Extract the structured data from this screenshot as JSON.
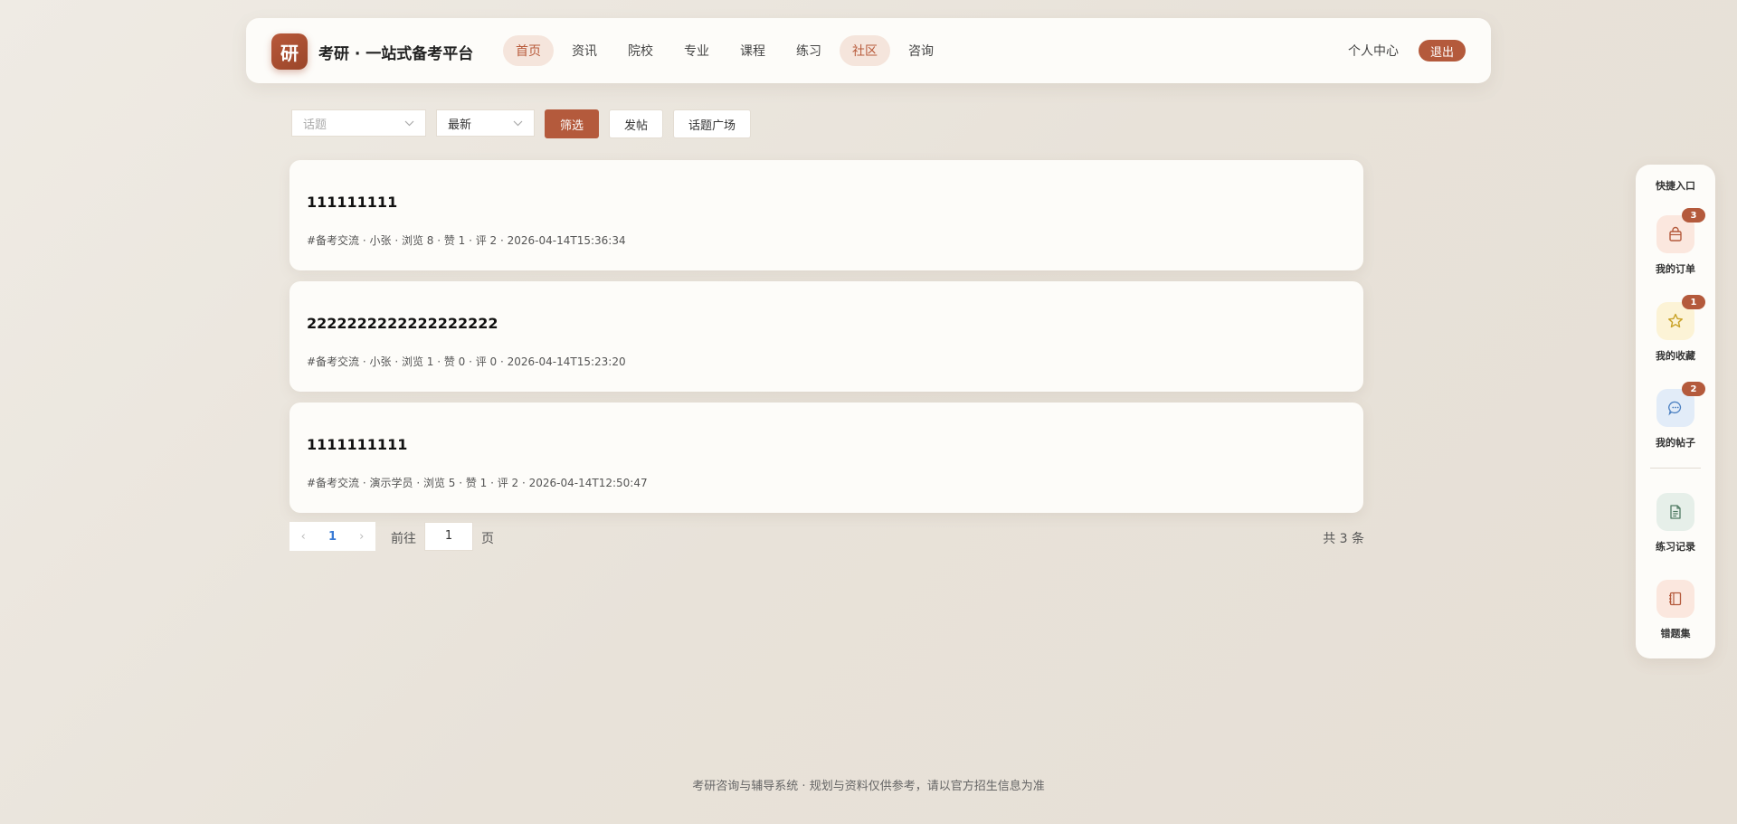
{
  "header": {
    "logo_char": "研",
    "brand": "考研 · 一站式备考平台",
    "nav": [
      {
        "label": "首页",
        "active": true
      },
      {
        "label": "资讯",
        "active": false
      },
      {
        "label": "院校",
        "active": false
      },
      {
        "label": "专业",
        "active": false
      },
      {
        "label": "课程",
        "active": false
      },
      {
        "label": "练习",
        "active": false
      },
      {
        "label": "社区",
        "active": true
      },
      {
        "label": "咨询",
        "active": false
      }
    ],
    "personal_center": "个人中心",
    "logout": "退出"
  },
  "filters": {
    "topic_placeholder": "话题",
    "sort_value": "最新",
    "filter_button": "筛选",
    "post_button": "发帖",
    "topic_square_button": "话题广场"
  },
  "posts": [
    {
      "title": "111111111",
      "meta": "#备考交流 · 小张 · 浏览 8 · 赞 1 · 评 2 · 2026-04-14T15:36:34"
    },
    {
      "title": "2222222222222222222",
      "meta": "#备考交流 · 小张 · 浏览 1 · 赞 0 · 评 0 · 2026-04-14T15:23:20"
    },
    {
      "title": "1111111111",
      "meta": "#备考交流 · 演示学员 · 浏览 5 · 赞 1 · 评 2 · 2026-04-14T12:50:47"
    }
  ],
  "pagination": {
    "current_page": "1",
    "goto_label": "前往",
    "goto_value": "1",
    "page_label": "页",
    "total": "共 3 条"
  },
  "footer": "考研咨询与辅导系统 · 规划与资料仅供参考，请以官方招生信息为准",
  "quick_panel": {
    "title": "快捷入口",
    "items": [
      {
        "label": "我的订单",
        "icon": "bag-icon",
        "badge": "3",
        "color": "#b45a3c",
        "bg": "#fbe7de"
      },
      {
        "label": "我的收藏",
        "icon": "star-icon",
        "badge": "1",
        "color": "#c9a227",
        "bg": "#fcf3d6"
      },
      {
        "label": "我的帖子",
        "icon": "chat-icon",
        "badge": "2",
        "color": "#4a7fc1",
        "bg": "#e2ecf8"
      },
      {
        "label": "练习记录",
        "icon": "document-icon",
        "badge": "",
        "color": "#4f7a63",
        "bg": "#e6efe9"
      },
      {
        "label": "错题集",
        "icon": "notebook-icon",
        "badge": "",
        "color": "#b45a3c",
        "bg": "#fbe7de"
      }
    ]
  },
  "colors": {
    "accent": "#b45a3c",
    "active_nav_bg": "#f5e5dc",
    "page_link": "#3a7bd5"
  }
}
